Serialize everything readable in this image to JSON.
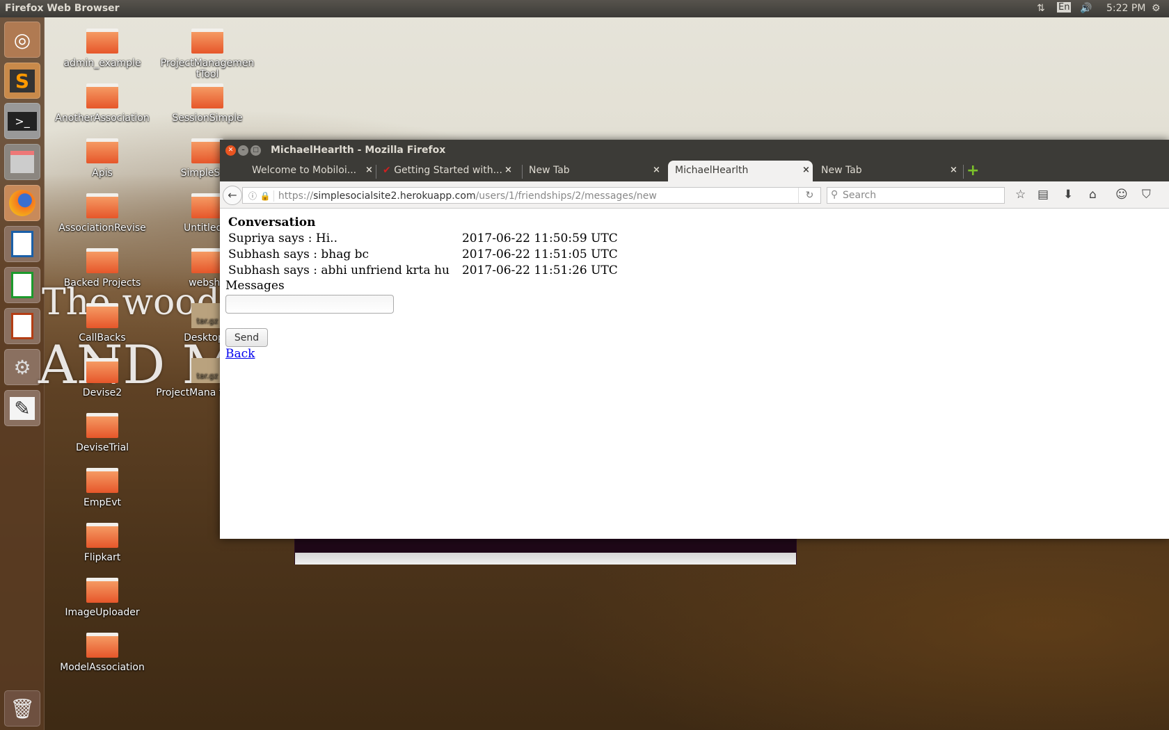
{
  "panel": {
    "app_title": "Firefox Web Browser",
    "language": "En",
    "clock": "5:22 PM"
  },
  "launcher": [
    "Ubuntu Dash",
    "Sublime Text",
    "Terminal",
    "Files",
    "Firefox",
    "LibreOffice Writer",
    "LibreOffice Calc",
    "LibreOffice Impress",
    "System Settings",
    "Text Editor",
    "Trash"
  ],
  "wallpaper_text": [
    "The woods",
    "AND M"
  ],
  "desktop": {
    "col1": [
      "admin_example",
      "AnotherAssociation",
      "Apis",
      "AssociationRevise",
      "Backed Projects",
      "CallBacks",
      "Devise2",
      "DeviseTrial",
      "EmpEvt",
      "Flipkart",
      "ImageUploader",
      "ModelAssociation"
    ],
    "col2": [
      {
        "label": "ProjectManagemen tTool",
        "type": "folder"
      },
      {
        "label": "SessionSimple",
        "type": "folder"
      },
      {
        "label": "SimpleSoci",
        "type": "folder"
      },
      {
        "label": "Untitled F",
        "type": "folder"
      },
      {
        "label": "websho",
        "type": "folder"
      },
      {
        "label": "Desktop.t",
        "type": "archive"
      },
      {
        "label": "ProjectMana tTool.tar",
        "type": "archive"
      }
    ],
    "archive_badge": "tar.gz"
  },
  "browser": {
    "window_title": "MichaelHearlth - Mozilla Firefox",
    "tabs": [
      {
        "label": "Welcome to Mobiloi..."
      },
      {
        "label": "Getting Started with..."
      },
      {
        "label": "New Tab"
      },
      {
        "label": "MichaelHearlth",
        "active": true
      },
      {
        "label": "New Tab"
      }
    ],
    "url_scheme": "https://",
    "url_host": "simplesocialsite2.herokuapp.com",
    "url_path": "/users/1/friendships/2/messages/new",
    "search_placeholder": "Search"
  },
  "page": {
    "heading": "Conversation",
    "messages": [
      {
        "sender": "Supriya says : ",
        "text": "Hi..",
        "time": "2017-06-22 11:50:59 UTC"
      },
      {
        "sender": "Subhash says : ",
        "text": "bhag bc",
        "time": "2017-06-22 11:51:05 UTC"
      },
      {
        "sender": "Subhash says : ",
        "text": "abhi unfriend krta hu",
        "time": "2017-06-22 11:51:26 UTC"
      }
    ],
    "input_label": "Messages",
    "input_value": "",
    "send_label": "Send",
    "back_label": "Back"
  }
}
